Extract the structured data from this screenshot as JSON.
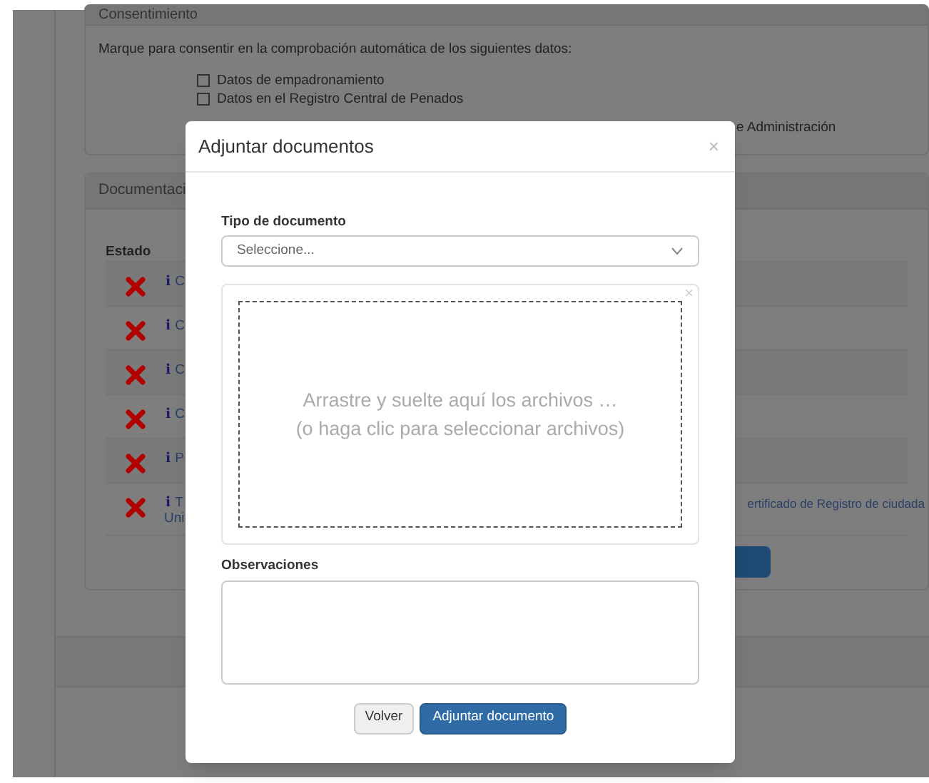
{
  "consent": {
    "title": "Consentimiento",
    "instruction": "Marque para consentir en la comprobación automática de los siguientes datos:",
    "options": [
      {
        "label": "Datos de empadronamiento",
        "checked": false
      },
      {
        "label": "Datos en el Registro Central de Penados",
        "checked": false
      }
    ],
    "option_tail": "e Administración"
  },
  "documents": {
    "title": "Documentaci",
    "status_header": "Estado",
    "rows": [
      {
        "valid": false,
        "info": "i",
        "link": "C"
      },
      {
        "valid": false,
        "info": "i",
        "link": "C"
      },
      {
        "valid": false,
        "info": "i",
        "link": "C"
      },
      {
        "valid": false,
        "info": "i",
        "link": "C"
      },
      {
        "valid": false,
        "info": "i",
        "link": "P"
      },
      {
        "valid": false,
        "info": "i",
        "link": "T",
        "link_line2": "Uni",
        "tail": "ertificado de Registro de ciudada"
      }
    ]
  },
  "modal": {
    "title": "Adjuntar documentos",
    "close": "×",
    "type_label": "Tipo de documento",
    "type_placeholder": "Seleccione...",
    "dropzone": {
      "line1": "Arrastre y suelte aquí los archivos …",
      "line2": "(o haga clic para seleccionar archivos)",
      "close": "×"
    },
    "notes_label": "Observaciones",
    "buttons": [
      {
        "label": "Volver",
        "kind": "secondary"
      },
      {
        "label": "Adjuntar documento",
        "kind": "primary"
      }
    ]
  }
}
